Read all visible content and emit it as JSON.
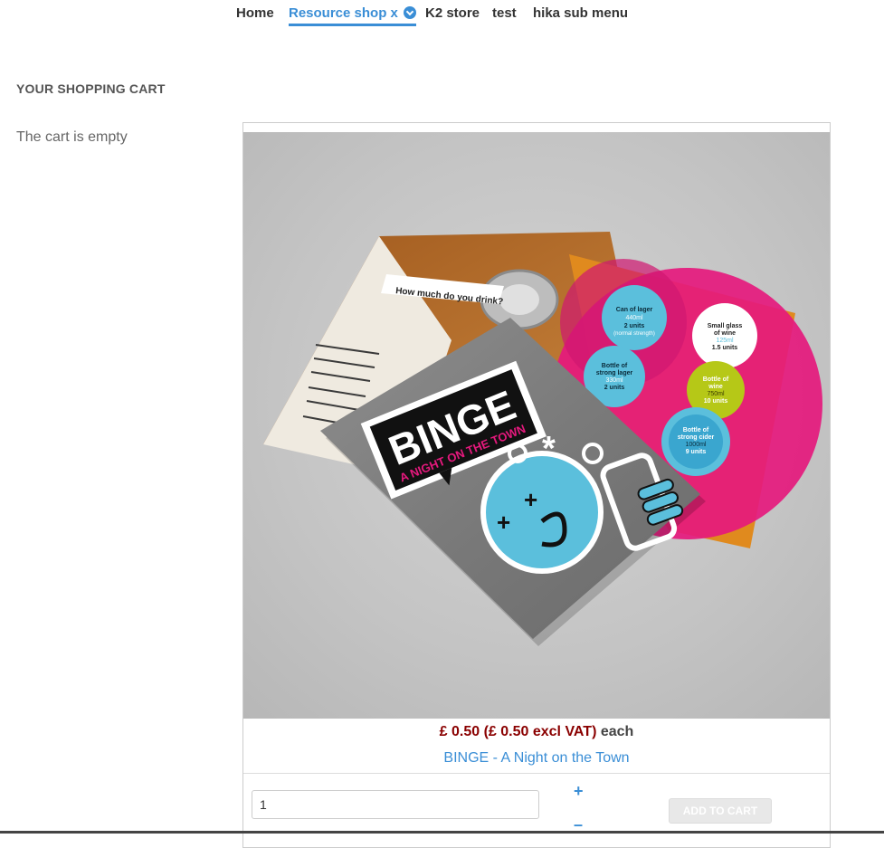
{
  "nav": {
    "items": [
      {
        "label": "Home"
      },
      {
        "label": "Resource shop x"
      },
      {
        "label": "K2 store"
      },
      {
        "label": "test"
      },
      {
        "label": "hika sub menu"
      }
    ]
  },
  "cart": {
    "title": "YOUR SHOPPING CART",
    "empty_text": "The cart is empty"
  },
  "product": {
    "image": {
      "alt": "BINGE - A Night on the Town leaflet",
      "leaflet_title": "BINGE",
      "leaflet_subtitle": "A NIGHT ON THE TOWN",
      "callout": "How much do you drink?",
      "bubbles": [
        {
          "lines": [
            "Can of lager",
            "440ml",
            "2 units",
            "(normal strength)"
          ]
        },
        {
          "lines": [
            "Small glass",
            "of wine",
            "125ml",
            "1.5 units"
          ]
        },
        {
          "lines": [
            "Bottle of",
            "strong lager",
            "330ml",
            "2 units"
          ]
        },
        {
          "lines": [
            "Bottle of",
            "wine",
            "750ml",
            "10 units"
          ]
        },
        {
          "lines": [
            "Bottle of",
            "strong cider",
            "1000ml",
            "9 units"
          ]
        }
      ]
    },
    "price": "£ 0.50 (£ 0.50 excl VAT)",
    "price_suffix": "each",
    "name": "BINGE - A Night on the Town",
    "quantity_value": "1",
    "plus_label": "+",
    "minus_label": "–",
    "add_to_cart_label": "ADD TO CART"
  },
  "colors": {
    "accent": "#3a8ed6",
    "price": "#8a0000",
    "cyan": "#5bbfdc",
    "magenta": "#e5197d",
    "orange": "#e08a1e",
    "lime": "#b6c817"
  }
}
